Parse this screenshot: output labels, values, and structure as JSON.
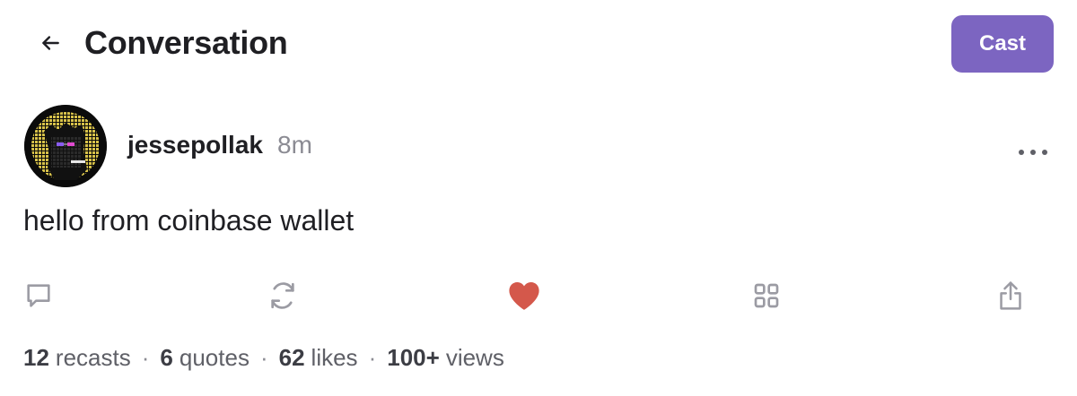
{
  "header": {
    "title": "Conversation",
    "cast_button_label": "Cast",
    "back_icon": "arrow-left-icon"
  },
  "cast": {
    "author": {
      "username": "jessepollak",
      "avatar": "pixel-avatar"
    },
    "timestamp": "8m",
    "text": "hello from coinbase wallet"
  },
  "actions": [
    {
      "name": "reply",
      "icon": "comment-icon"
    },
    {
      "name": "recast",
      "icon": "recast-icon"
    },
    {
      "name": "like",
      "icon": "heart-icon",
      "active": true
    },
    {
      "name": "apps",
      "icon": "grid-icon"
    },
    {
      "name": "share",
      "icon": "share-icon"
    }
  ],
  "stats": {
    "recasts_count": "12",
    "recasts_label": "recasts",
    "quotes_count": "6",
    "quotes_label": "quotes",
    "likes_count": "62",
    "likes_label": "likes",
    "views_count": "100+",
    "views_label": "views",
    "separator": "·"
  },
  "colors": {
    "accent": "#7c65c1",
    "like": "#d4584b",
    "muted": "#8b8b93",
    "icon": "#9b9ba3"
  }
}
